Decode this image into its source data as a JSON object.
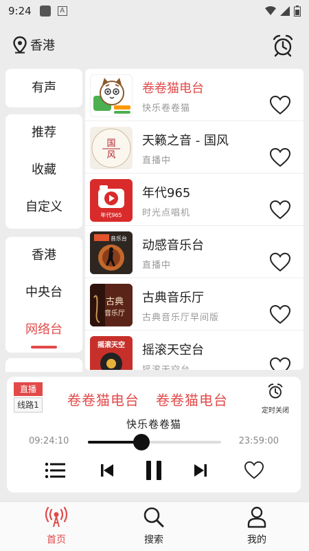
{
  "status_bar": {
    "time": "9:24",
    "a_icon": "A"
  },
  "header": {
    "location": "香港"
  },
  "sidebar": {
    "group1": [
      "有声"
    ],
    "group2": [
      "推荐",
      "收藏",
      "自定义"
    ],
    "group3": [
      "香港",
      "中央台",
      "网络台"
    ],
    "active": "网络台"
  },
  "stations": [
    {
      "title": "卷卷猫电台",
      "subtitle": "快乐卷卷猫",
      "active": true
    },
    {
      "title": "天籁之音 - 国风",
      "subtitle": "直播中",
      "active": false
    },
    {
      "title": "年代965",
      "subtitle": "时光点唱机",
      "active": false
    },
    {
      "title": "动感音乐台",
      "subtitle": "直播中",
      "active": false
    },
    {
      "title": "古典音乐厅",
      "subtitle": "古典音乐厅早间版",
      "active": false
    },
    {
      "title": "摇滚天空台",
      "subtitle": "摇滚天空台",
      "active": false
    }
  ],
  "thumb_texts": {
    "guofeng": "国风",
    "niandai": "年代965",
    "yinyue": "音乐台",
    "gudian": "古典音乐厅",
    "yaogun": "摇滚天空"
  },
  "player": {
    "live_tag": "直播",
    "line_tag": "线路1",
    "title": "卷卷猫电台",
    "subtitle": "快乐卷卷猫",
    "timer_label": "定时关闭",
    "current_time": "09:24:10",
    "end_time": "23:59:00",
    "progress": 0.4
  },
  "tabs": [
    {
      "label": "首页",
      "icon": "radio-icon",
      "active": true
    },
    {
      "label": "搜索",
      "icon": "search-icon",
      "active": false
    },
    {
      "label": "我的",
      "icon": "user-icon",
      "active": false
    }
  ],
  "colors": {
    "accent": "#e24a4a",
    "background": "#ececec"
  }
}
